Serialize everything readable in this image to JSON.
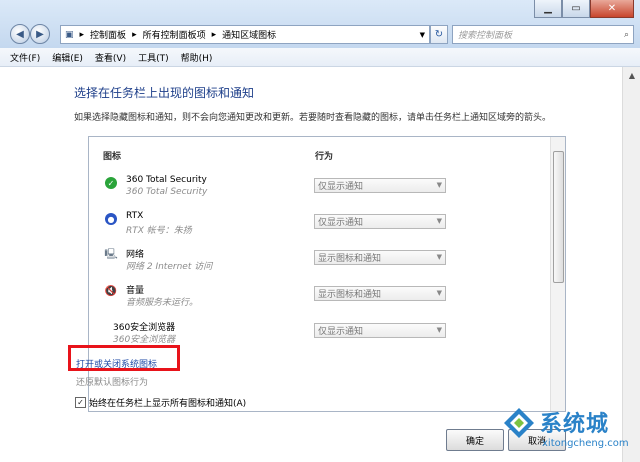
{
  "address": {
    "crumbs": [
      "控制面板",
      "所有控制面板项",
      "通知区域图标"
    ]
  },
  "search": {
    "placeholder": "搜索控制面板"
  },
  "menu": [
    "文件(F)",
    "编辑(E)",
    "查看(V)",
    "工具(T)",
    "帮助(H)"
  ],
  "main": {
    "heading": "选择在任务栏上出现的图标和通知",
    "description": "如果选择隐藏图标和通知，则不会向您通知更改和更新。若要随时查看隐藏的图标，请单击任务栏上通知区域旁的箭头。",
    "columns": {
      "icons": "图标",
      "behavior": "行为"
    },
    "rows": [
      {
        "name": "360 Total Security",
        "sub": "360 Total Security",
        "behavior": "仅显示通知",
        "icon": "shield-icon",
        "color": "#2aa43a"
      },
      {
        "name": "RTX",
        "sub": "RTX 帐号：朱扬",
        "behavior": "仅显示通知",
        "icon": "rtx-icon",
        "color": "#2a55c4"
      },
      {
        "name": "网络",
        "sub": "网络 2 Internet 访问",
        "behavior": "显示图标和通知",
        "icon": "network-icon",
        "color": "#6a7a8a"
      },
      {
        "name": "音量",
        "sub": "音频服务未运行。",
        "behavior": "显示图标和通知",
        "icon": "volume-icon",
        "color": "#d42a1a"
      },
      {
        "name": "360安全浏览器",
        "sub": "360安全浏览器",
        "behavior": "仅显示通知",
        "icon": "browser-icon",
        "color": "#3a9a3a"
      }
    ],
    "link_system_icons": "打开或关闭系统图标",
    "link_restore": "还原默认图标行为",
    "checkbox_label": "始终在任务栏上显示所有图标和通知(A)",
    "checkbox_checked": true,
    "ok_label": "确定",
    "cancel_label": "取消"
  },
  "watermark": {
    "text": "系统城",
    "url": "xitongcheng.com"
  }
}
